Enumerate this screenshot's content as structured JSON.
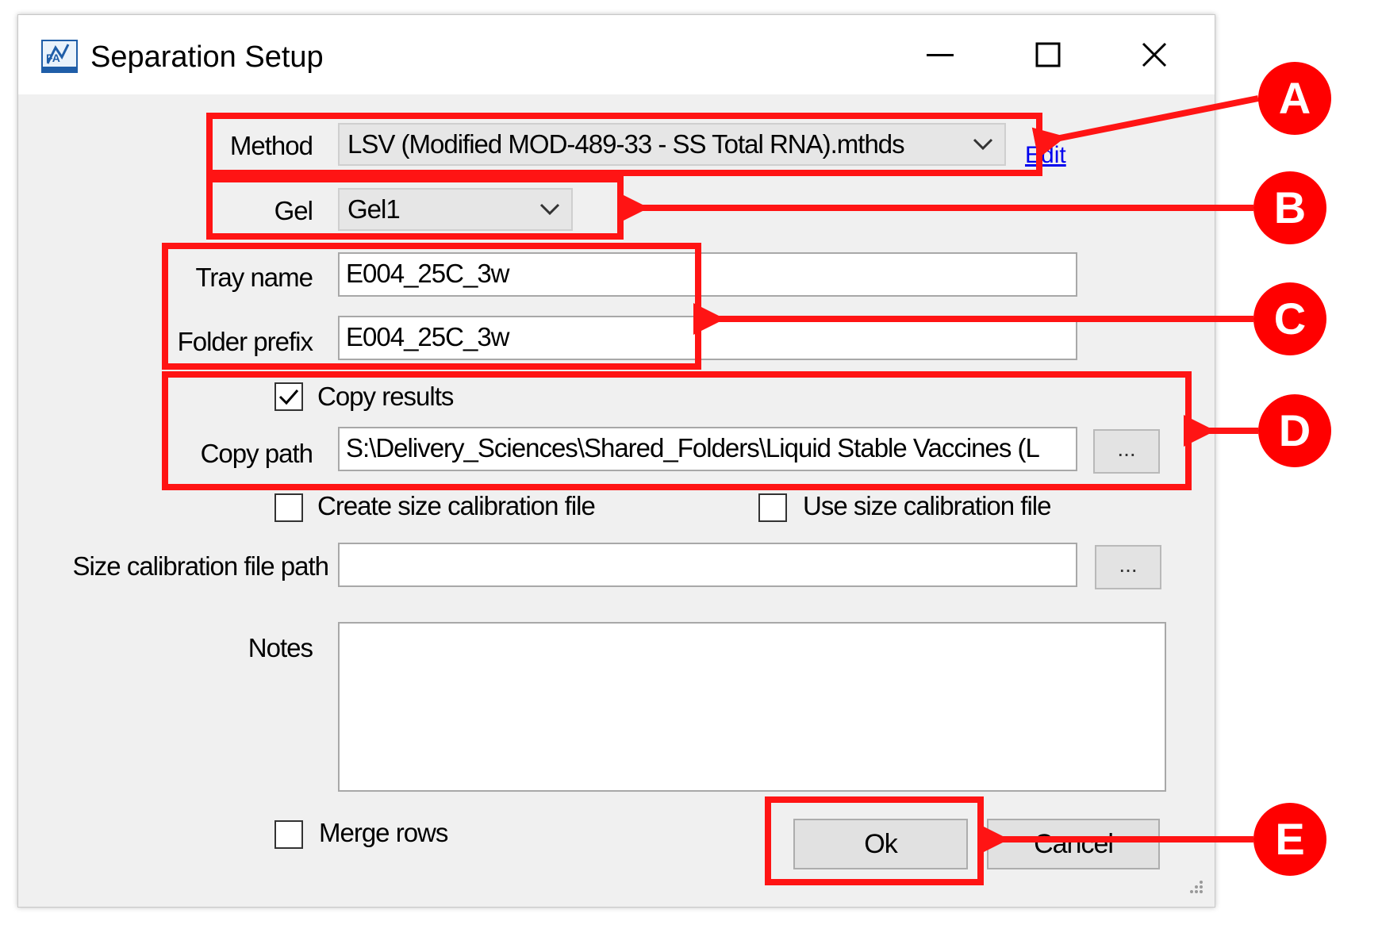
{
  "window": {
    "title": "Separation Setup",
    "icon": "fa-app-icon",
    "icon_text": "FA"
  },
  "form": {
    "method_label": "Method",
    "method_value": "LSV (Modified MOD-489-33 - SS Total RNA).mthds",
    "edit_link": "Edit",
    "gel_label": "Gel",
    "gel_value": "Gel1",
    "tray_name_label": "Tray name",
    "tray_name_value": "E004_25C_3w",
    "folder_prefix_label": "Folder prefix",
    "folder_prefix_value": "E004_25C_3w",
    "copy_results_label": "Copy results",
    "copy_results_checked": true,
    "copy_path_label": "Copy path",
    "copy_path_value": "S:\\Delivery_Sciences\\Shared_Folders\\Liquid Stable Vaccines (L",
    "browse_label": "...",
    "create_size_cal_label": "Create size calibration file",
    "use_size_cal_label": "Use size calibration file",
    "size_cal_path_label": "Size calibration file path",
    "size_cal_path_value": "",
    "notes_label": "Notes",
    "notes_value": "",
    "merge_rows_label": "Merge rows",
    "ok_label": "Ok",
    "cancel_label": "Cancel"
  },
  "annotations": [
    "A",
    "B",
    "C",
    "D",
    "E"
  ],
  "colors": {
    "annotation": "#ff1414",
    "link": "#0000ee"
  }
}
